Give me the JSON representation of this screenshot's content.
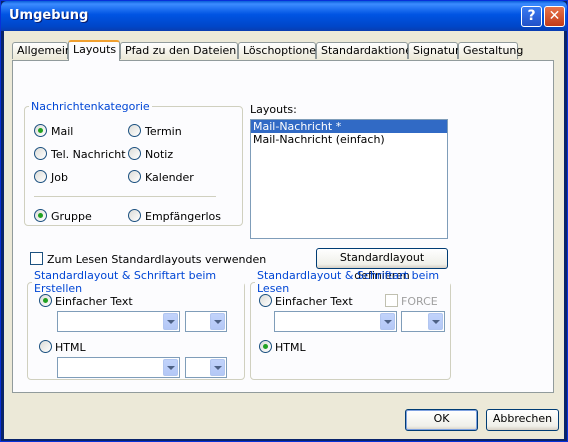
{
  "window": {
    "title": "Umgebung",
    "help_label": "?",
    "close_label": "✕"
  },
  "tabs": [
    "Allgemein",
    "Layouts",
    "Pfad zu den Dateien",
    "Löschoptionen",
    "Standardaktionen",
    "Signatur",
    "Gestaltung"
  ],
  "category": {
    "legend": "Nachrichtenkategorie",
    "mail": "Mail",
    "termin": "Termin",
    "tel": "Tel. Nachricht",
    "notiz": "Notiz",
    "job": "Job",
    "kalender": "Kalender",
    "gruppe": "Gruppe",
    "empfaengerlos": "Empfängerlos"
  },
  "layouts": {
    "label": "Layouts:",
    "items": [
      "Mail-Nachricht *",
      "Mail-Nachricht (einfach)"
    ]
  },
  "use_default_label": "Zum Lesen Standardlayouts verwenden",
  "define_button": "Standardlayout definieren",
  "create_group": {
    "legend": "Standardlayout & Schriftart beim Erstellen",
    "plain": "Einfacher Text",
    "html": "HTML"
  },
  "read_group": {
    "legend": "Standardlayout & Schriftart beim Lesen",
    "plain": "Einfacher Text",
    "force": "FORCE",
    "html": "HTML"
  },
  "footer": {
    "ok": "OK",
    "cancel": "Abbrechen"
  }
}
